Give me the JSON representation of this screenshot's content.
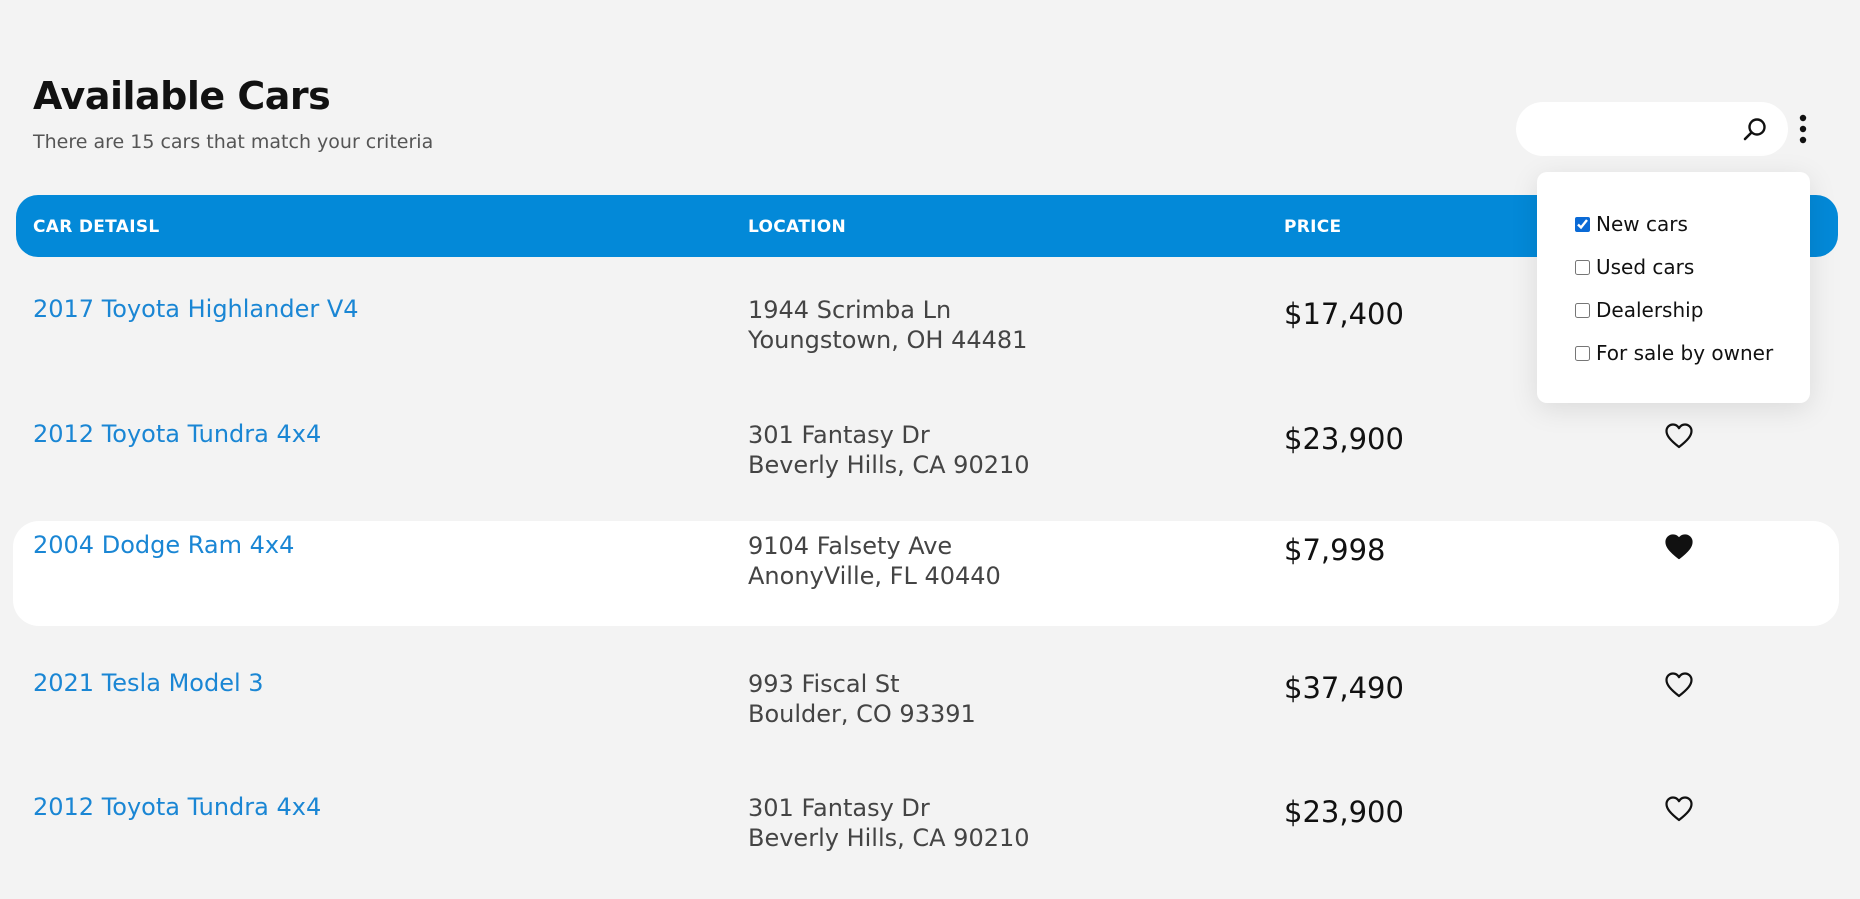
{
  "header": {
    "title": "Available Cars",
    "subtitle": "There are 15 cars that match your criteria"
  },
  "search": {
    "value": "",
    "placeholder": ""
  },
  "table": {
    "columns": [
      "CAR DETAISL",
      "LOCATION",
      "PRICE"
    ],
    "rows": [
      {
        "name": "2017 Toyota Highlander V4",
        "address": "1944 Scrimba Ln",
        "city": "Youngstown, OH 44481",
        "price": "$17,400",
        "favorited": false
      },
      {
        "name": "2012 Toyota Tundra 4x4",
        "address": "301 Fantasy Dr",
        "city": "Beverly Hills, CA 90210",
        "price": "$23,900",
        "favorited": false
      },
      {
        "name": "2004 Dodge Ram 4x4",
        "address": "9104 Falsety Ave",
        "city": "AnonyVille, FL 40440",
        "price": "$7,998",
        "favorited": true
      },
      {
        "name": "2021 Tesla Model 3",
        "address": "993 Fiscal St",
        "city": "Boulder, CO 93391",
        "price": "$37,490",
        "favorited": false
      },
      {
        "name": "2012 Toyota Tundra 4x4",
        "address": "301 Fantasy Dr",
        "city": "Beverly Hills, CA 90210",
        "price": "$23,900",
        "favorited": false
      }
    ]
  },
  "filter_menu": {
    "options": [
      {
        "label": "New cars",
        "checked": true
      },
      {
        "label": "Used cars",
        "checked": false
      },
      {
        "label": "Dealership",
        "checked": false
      },
      {
        "label": "For sale by owner",
        "checked": false
      }
    ]
  },
  "icons": {
    "search": "search-icon",
    "menu": "kebab-menu-icon",
    "favorite": "heart-icon"
  },
  "colors": {
    "accent": "#0389d8",
    "link": "#1a86d4",
    "background": "#f3f3f3"
  }
}
